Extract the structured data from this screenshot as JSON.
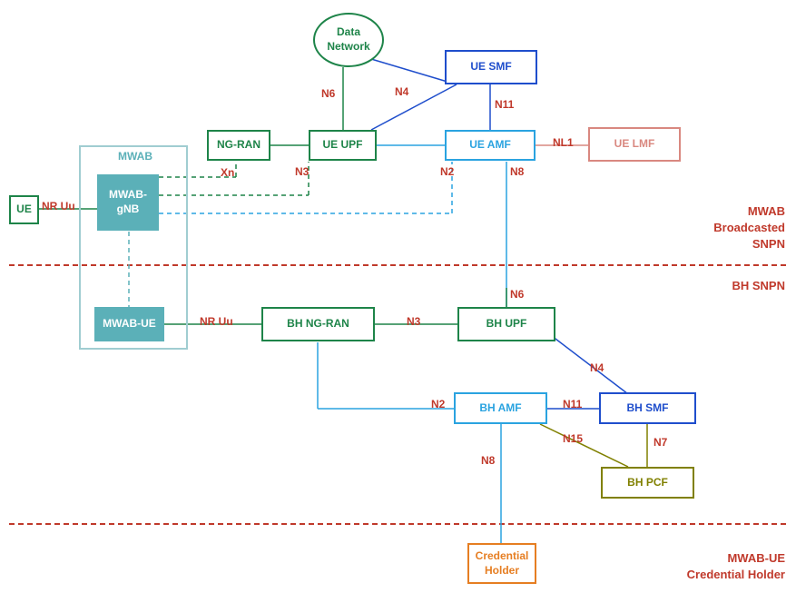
{
  "nodes": {
    "data_network": "Data\nNetwork",
    "ue_smf": "UE SMF",
    "ng_ran": "NG-RAN",
    "ue_upf": "UE UPF",
    "ue_amf": "UE AMF",
    "ue_lmf": "UE LMF",
    "ue": "UE",
    "mwab": "MWAB",
    "mwab_gnb": "MWAB-\ngNB",
    "mwab_ue": "MWAB-UE",
    "bh_ng_ran": "BH NG-RAN",
    "bh_upf": "BH UPF",
    "bh_amf": "BH AMF",
    "bh_smf": "BH SMF",
    "bh_pcf": "BH PCF",
    "credential_holder": "Credential\nHolder"
  },
  "links": {
    "n6_a": "N6",
    "n4_a": "N4",
    "n11_a": "N11",
    "nl1": "NL1",
    "xn": "Xn",
    "n3_a": "N3",
    "n2_a": "N2",
    "n8_a": "N8",
    "nr_uu_a": "NR Uu",
    "nr_uu_b": "NR Uu",
    "n3_b": "N3",
    "n6_b": "N6",
    "n4_b": "N4",
    "n2_b": "N2",
    "n11_b": "N11",
    "n15": "N15",
    "n7": "N7",
    "n8_b": "N8"
  },
  "sections": {
    "mwab_broadcasted": "MWAB\nBroadcasted\nSNPN",
    "bh_snpn": "BH SNPN",
    "mwab_ue_ch": "MWAB-UE\nCredential Holder"
  },
  "colors": {
    "green": "#1e8449",
    "blue": "#1f4ecc",
    "cyan": "#2aa3e0",
    "olive": "#808000",
    "pink": "#d98880",
    "orange": "#e67e22",
    "red": "#c0392b",
    "teal": "#5bb0b8"
  }
}
